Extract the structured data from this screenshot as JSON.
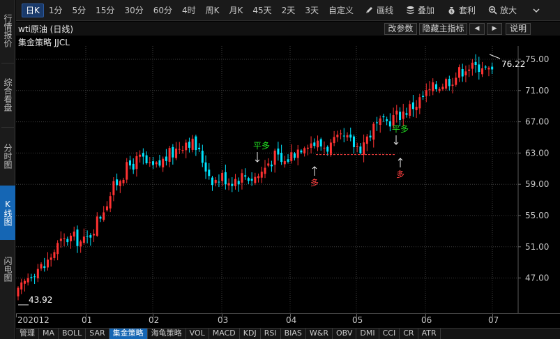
{
  "left_tabs": [
    {
      "label": "行情报价",
      "active": false
    },
    {
      "label": "综合看盘",
      "active": false
    },
    {
      "label": "分时图",
      "active": false
    },
    {
      "label": "K线图",
      "active": true
    },
    {
      "label": "闪电图",
      "active": false
    }
  ],
  "toolbar": {
    "periods": [
      "日K",
      "1分",
      "5分",
      "15分",
      "30分",
      "60分",
      "4时",
      "周K",
      "月K",
      "45天",
      "2天",
      "3天",
      "自定义"
    ],
    "active_period": "日K",
    "tools": [
      {
        "label": "画线",
        "icon": "pencil-icon"
      },
      {
        "label": "叠加",
        "icon": "stack-icon"
      },
      {
        "label": "套利",
        "icon": "bag-icon"
      },
      {
        "label": "放大",
        "icon": "zoom-icon"
      }
    ],
    "more_icon": "chevron-down-icon"
  },
  "title_row": {
    "title": "wti原油 (日线)",
    "edit_params": "改参数",
    "hide_indicator": "隐藏主指标",
    "prev": "◀",
    "next": "▶",
    "help": "说明"
  },
  "strategy_label": "集金策略 JJCL",
  "colors": {
    "up": "#ff3232",
    "down": "#00e5ff",
    "signal_buy": "#ff4040",
    "signal_flat": "#22e022",
    "accent": "#1566b4"
  },
  "chart_data": {
    "type": "candlestick",
    "ylim": [
      43.0,
      76.5
    ],
    "y_ticks": [
      "75.00",
      "71.00",
      "67.00",
      "63.00",
      "59.00",
      "55.00",
      "51.00",
      "47.00"
    ],
    "x_labels": [
      "202012",
      "01",
      "02",
      "03",
      "04",
      "05",
      "06",
      "07"
    ],
    "max_label": "76.22",
    "min_label": "43.92",
    "signals": [
      {
        "text": "平多",
        "kind": "flat"
      },
      {
        "text": "多",
        "kind": "buy"
      },
      {
        "text": "平多",
        "kind": "flat"
      },
      {
        "text": "多",
        "kind": "buy"
      }
    ]
  },
  "bottom_tabs": [
    "管理",
    "MA",
    "BOLL",
    "SAR",
    "集金策略",
    "海龟策略",
    "VOL",
    "MACD",
    "KDJ",
    "RSI",
    "BIAS",
    "W&R",
    "OBV",
    "DMI",
    "CCI",
    "CR",
    "ATR"
  ],
  "bottom_active": "集金策略"
}
